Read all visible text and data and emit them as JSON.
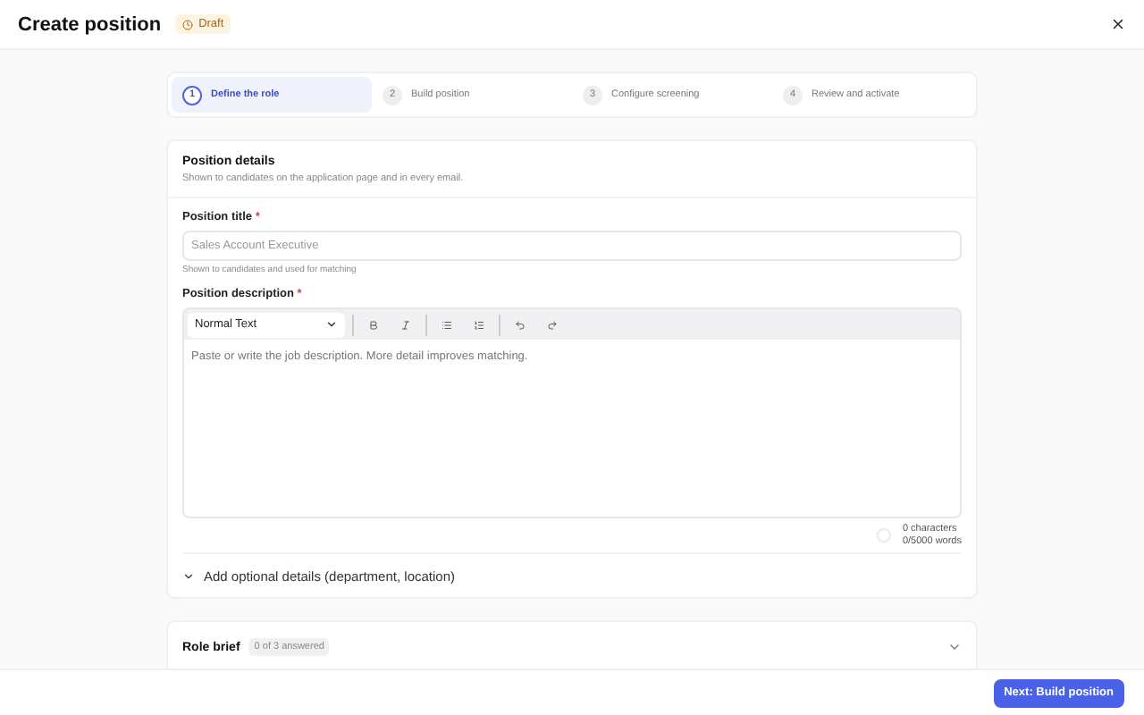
{
  "header": {
    "title": "Create position",
    "status": "Draft"
  },
  "steps": [
    {
      "number": "1",
      "label": "Define the role",
      "selected": true
    },
    {
      "number": "2",
      "label": "Build position",
      "selected": false
    },
    {
      "number": "3",
      "label": "Configure screening",
      "selected": false
    },
    {
      "number": "4",
      "label": "Review and activate",
      "selected": false
    }
  ],
  "details": {
    "title": "Position details",
    "subtitle": "Shown to candidates on the application page and in every email.",
    "title_field": {
      "label": "Position title",
      "required_mark": "*",
      "placeholder": "Sales Account Executive",
      "hint": "Shown to candidates and used for matching"
    },
    "description_field": {
      "label": "Position description",
      "required_mark": "*",
      "format": "Normal Text",
      "placeholder": "Paste or write the job description. More detail improves matching.",
      "characters": "0 characters",
      "words": "0/5000 words"
    },
    "optional": {
      "label": "Add optional details (department, location)",
      "expanded": false
    }
  },
  "role_brief": {
    "title": "Role brief",
    "badge": "0 of 3 answered",
    "expanded": false
  },
  "footer": {
    "next_button": "Next: Build position"
  }
}
